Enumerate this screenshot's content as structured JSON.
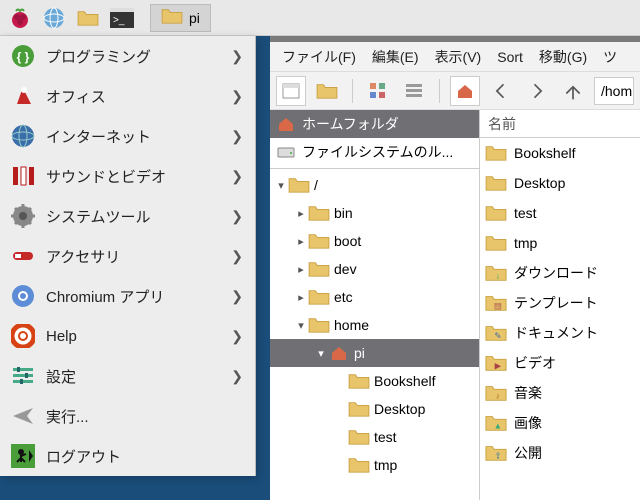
{
  "taskbar": {
    "active_app": "pi"
  },
  "menu": {
    "items": [
      {
        "label": "プログラミング",
        "icon": "code-icon",
        "sub": true
      },
      {
        "label": "オフィス",
        "icon": "office-icon",
        "sub": true
      },
      {
        "label": "インターネット",
        "icon": "globe-icon",
        "sub": true
      },
      {
        "label": "サウンドとビデオ",
        "icon": "media-icon",
        "sub": true
      },
      {
        "label": "システムツール",
        "icon": "system-icon",
        "sub": true
      },
      {
        "label": "アクセサリ",
        "icon": "accessory-icon",
        "sub": true
      },
      {
        "label": "Chromium アプリ",
        "icon": "chromium-icon",
        "sub": true
      },
      {
        "label": "Help",
        "icon": "help-icon",
        "sub": true
      },
      {
        "label": "設定",
        "icon": "settings-icon",
        "sub": true
      },
      {
        "label": "実行...",
        "icon": "run-icon",
        "sub": false
      },
      {
        "label": "ログアウト",
        "icon": "logout-icon",
        "sub": false
      }
    ]
  },
  "filemgr": {
    "menubar": [
      "ファイル(F)",
      "編集(E)",
      "表示(V)",
      "Sort",
      "移動(G)",
      "ツ"
    ],
    "path": "/hom",
    "side_places": [
      {
        "label": "ホームフォルダ",
        "icon": "home-icon",
        "sel": true
      },
      {
        "label": "ファイルシステムのル...",
        "icon": "disk-icon",
        "sel": false
      }
    ],
    "tree": [
      {
        "label": "/",
        "depth": 0,
        "exp": "▾",
        "icon": "folder"
      },
      {
        "label": "bin",
        "depth": 1,
        "exp": "▸",
        "icon": "folder"
      },
      {
        "label": "boot",
        "depth": 1,
        "exp": "▸",
        "icon": "folder"
      },
      {
        "label": "dev",
        "depth": 1,
        "exp": "▸",
        "icon": "folder"
      },
      {
        "label": "etc",
        "depth": 1,
        "exp": "▸",
        "icon": "folder"
      },
      {
        "label": "home",
        "depth": 1,
        "exp": "▾",
        "icon": "folder"
      },
      {
        "label": "pi",
        "depth": 2,
        "exp": "▾",
        "icon": "home",
        "sel": true
      },
      {
        "label": "Bookshelf",
        "depth": 3,
        "exp": "",
        "icon": "folder"
      },
      {
        "label": "Desktop",
        "depth": 3,
        "exp": "",
        "icon": "folder"
      },
      {
        "label": "test",
        "depth": 3,
        "exp": "",
        "icon": "folder"
      },
      {
        "label": "tmp",
        "depth": 3,
        "exp": "",
        "icon": "folder"
      }
    ],
    "content_header": "名前",
    "files": [
      {
        "label": "Bookshelf",
        "icon": "folder"
      },
      {
        "label": "Desktop",
        "icon": "folder"
      },
      {
        "label": "test",
        "icon": "folder"
      },
      {
        "label": "tmp",
        "icon": "folder"
      },
      {
        "label": "ダウンロード",
        "icon": "folder-dl"
      },
      {
        "label": "テンプレート",
        "icon": "folder-tpl"
      },
      {
        "label": "ドキュメント",
        "icon": "folder-doc"
      },
      {
        "label": "ビデオ",
        "icon": "folder-vid"
      },
      {
        "label": "音楽",
        "icon": "folder-mus"
      },
      {
        "label": "画像",
        "icon": "folder-pic"
      },
      {
        "label": "公開",
        "icon": "folder-pub"
      }
    ]
  }
}
